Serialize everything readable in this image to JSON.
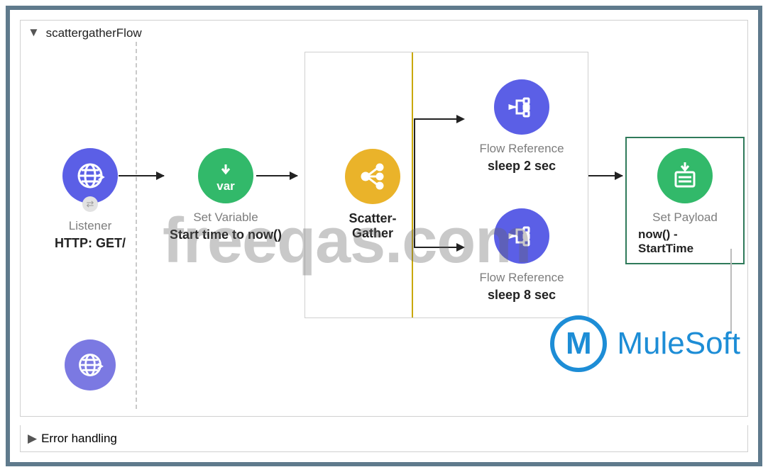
{
  "flow": {
    "title": "scattergatherFlow",
    "error_handling_label": "Error handling"
  },
  "listener": {
    "type": "Listener",
    "subtitle": "HTTP: GET/"
  },
  "setvar": {
    "icon_text": "var",
    "type": "Set Variable",
    "subtitle": "Start time to now()"
  },
  "scatter_gather": {
    "label": "Scatter-Gather"
  },
  "ref1": {
    "type": "Flow Reference",
    "subtitle": "sleep 2 sec"
  },
  "ref2": {
    "type": "Flow Reference",
    "subtitle": "sleep 8 sec"
  },
  "set_payload": {
    "type": "Set Payload",
    "subtitle": "now() - StartTime"
  },
  "watermark": "freeqas.com",
  "brand": "MuleSoft"
}
